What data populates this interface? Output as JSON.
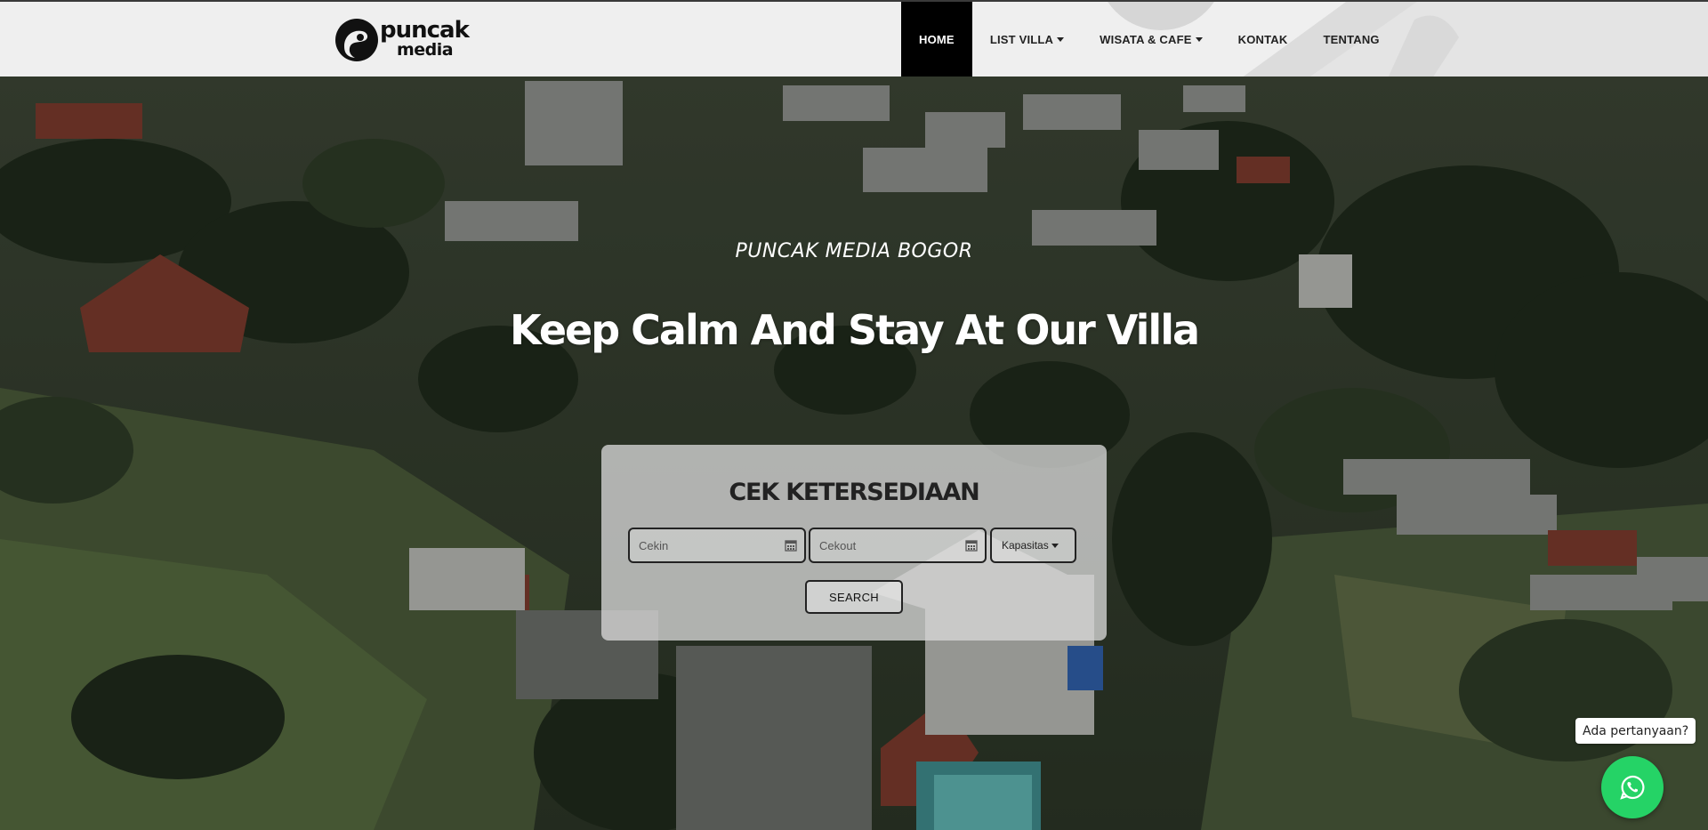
{
  "header": {
    "logo": {
      "word1": "puncak",
      "word2": "media"
    },
    "nav": [
      {
        "label": "HOME",
        "active": true
      },
      {
        "label": "LIST VILLA",
        "dropdown": true
      },
      {
        "label": "WISATA & CAFE",
        "dropdown": true
      },
      {
        "label": "KONTAK"
      },
      {
        "label": "TENTANG"
      }
    ]
  },
  "hero": {
    "subtitle": "PUNCAK MEDIA BOGOR",
    "title": "Keep Calm And Stay At Our Villa"
  },
  "availability": {
    "title": "CEK KETERSEDIAAN",
    "checkin_placeholder": "Cekin",
    "checkout_placeholder": "Cekout",
    "capacity_label": "Kapasitas",
    "search_label": "SEARCH"
  },
  "whatsapp": {
    "tooltip": "Ada pertanyaan?",
    "icon": "whatsapp-icon",
    "color": "#25d366"
  },
  "colors": {
    "nav_active_bg": "#000000",
    "header_bg": "#efefef",
    "whatsapp": "#25d366"
  }
}
